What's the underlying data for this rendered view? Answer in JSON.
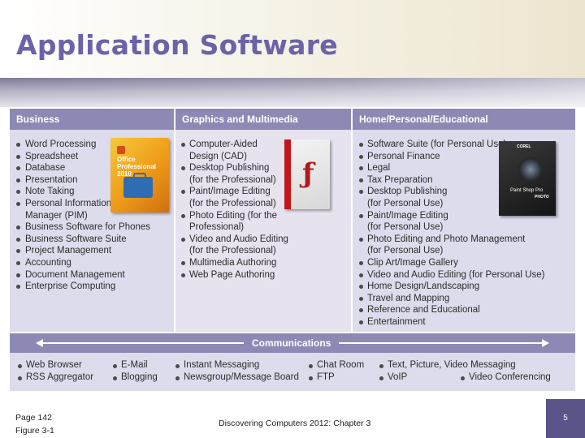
{
  "slide": {
    "title": "Application Software",
    "page_ref": "Page 142",
    "figure_ref": "Figure 3-1",
    "footer_center": "Discovering Computers 2012: Chapter 3",
    "slide_number": "5"
  },
  "figure": {
    "columns": [
      {
        "heading": "Business",
        "items": [
          "Word Processing",
          "Spreadsheet",
          "Database",
          "Presentation",
          "Note Taking",
          "Personal Information",
          "Manager (PIM)",
          "Business Software for Phones",
          "Business Software Suite",
          "Project Management",
          "Accounting",
          "Document Management",
          "Enterprise Computing"
        ]
      },
      {
        "heading": "Graphics and Multimedia",
        "items": [
          "Computer-Aided",
          "Design (CAD)",
          "Desktop Publishing",
          "(for the Professional)",
          "Paint/Image Editing",
          "(for the Professional)",
          "Photo Editing (for the",
          "Professional)",
          "Video and Audio Editing",
          "(for the Professional)",
          "Multimedia Authoring",
          "Web Page Authoring"
        ]
      },
      {
        "heading": "Home/Personal/Educational",
        "items": [
          "Software Suite (for Personal Use)",
          "Personal Finance",
          "Legal",
          "Tax Preparation",
          "Desktop Publishing",
          "(for Personal Use)",
          "Paint/Image Editing",
          "(for Personal Use)",
          "Photo Editing and Photo Management",
          "(for Personal Use)",
          "Clip Art/Image Gallery",
          "Video and Audio Editing (for Personal Use)",
          "Home Design/Landscaping",
          "Travel and Mapping",
          "Reference and Educational",
          "Entertainment"
        ]
      }
    ],
    "products": {
      "office_name": "Office Professional 2010",
      "corel_brand": "COREL",
      "corel_name": "Paint Shop Pro",
      "corel_sub": "PHOTO"
    },
    "communications": {
      "heading": "Communications",
      "items": [
        "Web Browser",
        "RSS Aggregator",
        "E-Mail",
        "Blogging",
        "Instant Messaging",
        "Newsgroup/Message Board",
        "Chat Room",
        "FTP",
        "Text, Picture, Video Messaging",
        "VoIP",
        "Video Conferencing"
      ]
    }
  }
}
